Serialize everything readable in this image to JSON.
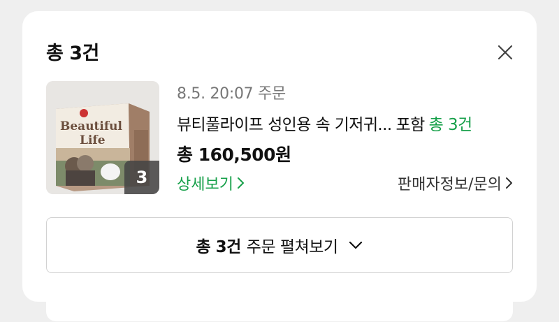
{
  "header": {
    "title": "총 3건"
  },
  "order": {
    "datetime": "8.5. 20:07 주문",
    "product_name": "뷰티풀라이프 성인용 속 기저귀...",
    "includes_label": "포함",
    "count_label": "총 3건",
    "price": "총 160,500원",
    "thumbnail_badge": "3",
    "product_image_text": {
      "brand_line1": "Beautiful",
      "brand_line2": "Life"
    },
    "detail_link": "상세보기",
    "seller_link": "판매자정보/문의"
  },
  "expand_button": {
    "bold": "총 3건",
    "label": "주문 펼쳐보기"
  },
  "colors": {
    "accent_green": "#17a04a",
    "text": "#111111",
    "muted": "#777777",
    "border": "#d2d2d2"
  }
}
